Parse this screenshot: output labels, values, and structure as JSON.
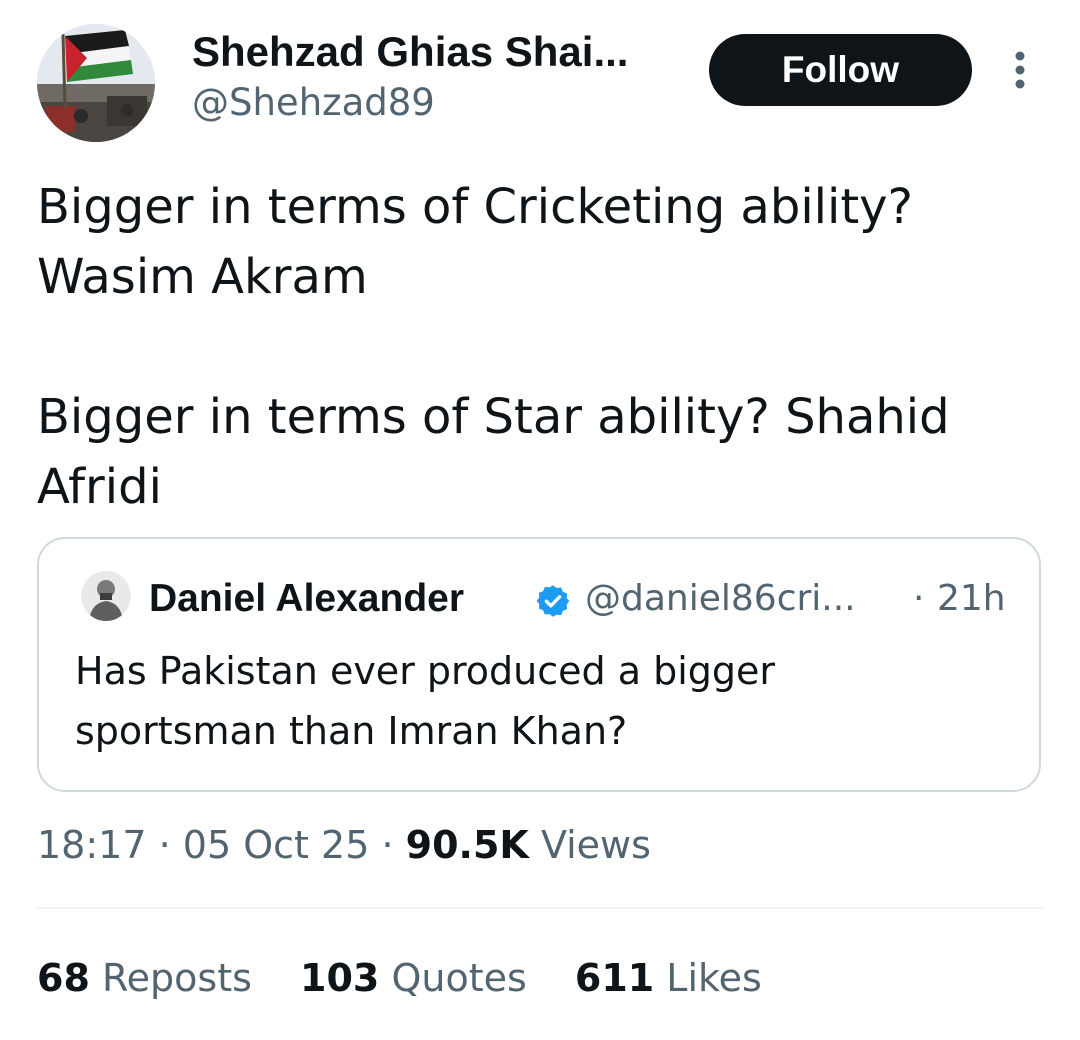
{
  "author": {
    "display_name": "Shehzad Ghias Shai...",
    "handle": "@Shehzad89"
  },
  "header": {
    "follow_label": "Follow",
    "more_icon": "more-vertical-icon"
  },
  "tweet": {
    "text": "Bigger in terms of Cricketing ability? Wasim Akram\n\nBigger in terms of Star ability? Shahid Afridi"
  },
  "quote": {
    "name": "Daniel Alexander",
    "verified_icon": "verified-badge-icon",
    "handle": "@daniel86cri...",
    "separator": "·",
    "time": "21h",
    "text": "Has Pakistan ever produced a bigger sportsman than Imran Khan?"
  },
  "meta": {
    "time": "18:17",
    "separator": "·",
    "date": "05 Oct 25",
    "views_count": "90.5K",
    "views_label": "Views"
  },
  "stats": {
    "reposts_count": "68",
    "reposts_label": "Reposts",
    "quotes_count": "103",
    "quotes_label": "Quotes",
    "likes_count": "611",
    "likes_label": "Likes"
  },
  "colors": {
    "text_primary": "#0f1419",
    "text_secondary": "#536471",
    "border": "#cfd9de",
    "verified_blue": "#1d9bf0",
    "follow_bg": "#0f1419"
  }
}
